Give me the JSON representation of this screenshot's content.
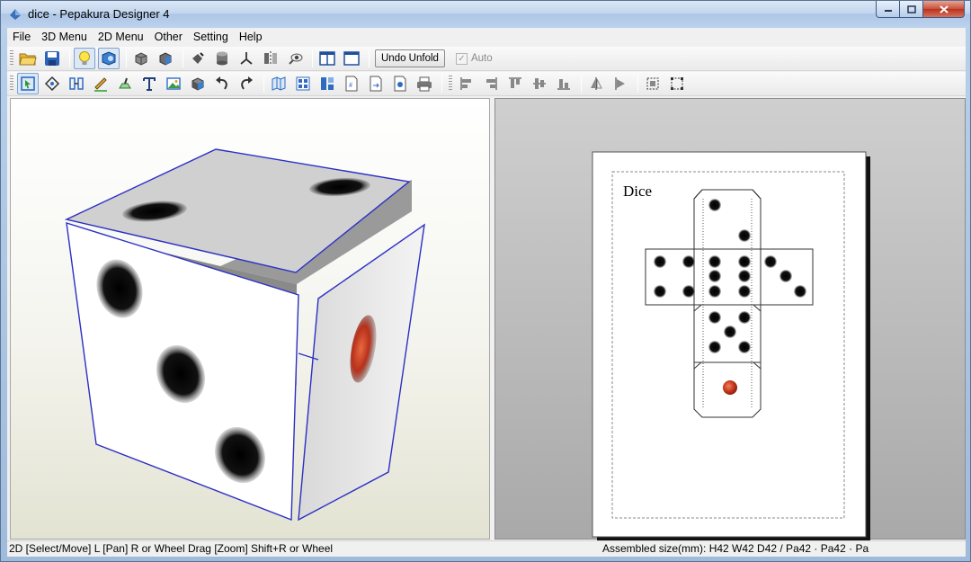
{
  "window": {
    "title": "dice - Pepakura Designer 4"
  },
  "menu": [
    "File",
    "3D Menu",
    "2D Menu",
    "Other",
    "Setting",
    "Help"
  ],
  "toolbar": {
    "undo_unfold_label": "Undo Unfold",
    "auto_label": "Auto",
    "auto_checked": true
  },
  "pattern": {
    "title": "Dice"
  },
  "status": {
    "hint": "2D [Select/Move] L [Pan] R or Wheel Drag [Zoom] Shift+R or Wheel",
    "assembled_size": "Assembled size(mm): H42 W42 D42 / Pa42 · Pa42 · Pa"
  },
  "colors": {
    "edge": "#2c2fc4",
    "pip": "#111111",
    "pip_red": "#c8381c"
  }
}
